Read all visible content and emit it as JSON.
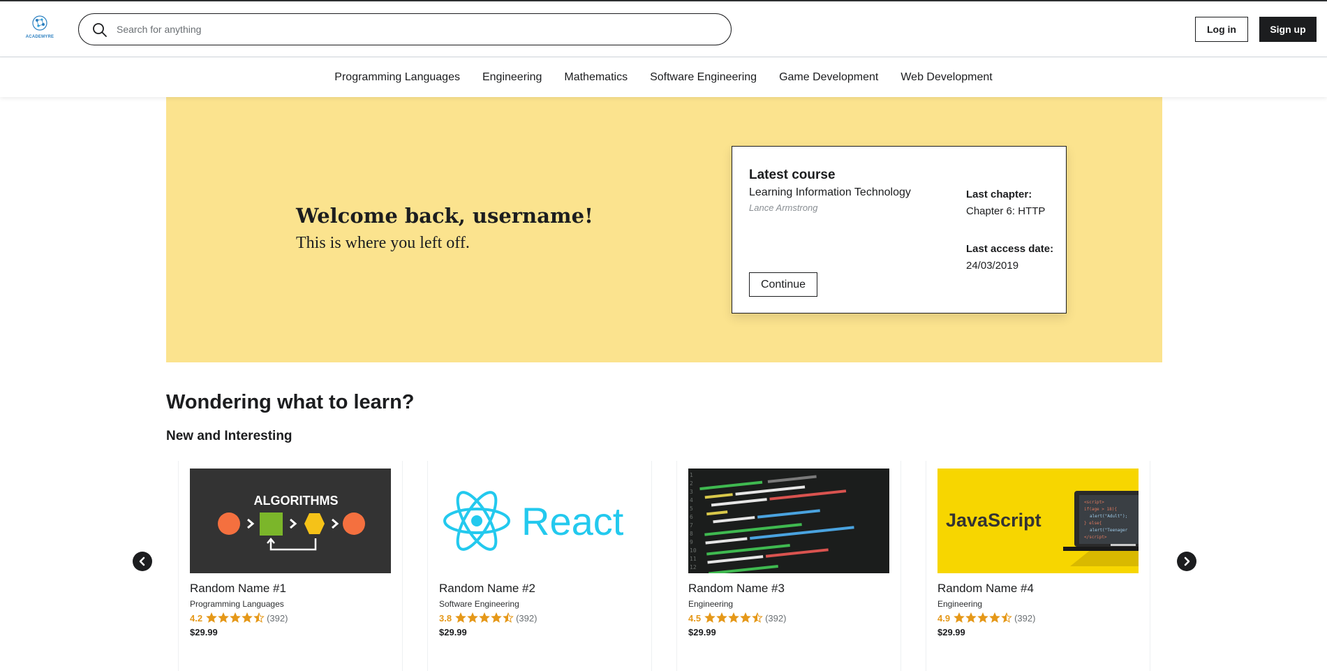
{
  "header": {
    "logo_text": "ACADEMYRE",
    "search_placeholder": "Search for anything",
    "login_label": "Log in",
    "signup_label": "Sign up"
  },
  "categories": [
    "Programming Languages",
    "Engineering",
    "Mathematics",
    "Software Engineering",
    "Game Development",
    "Web Development"
  ],
  "hero": {
    "title": "Welcome back, username!",
    "subtitle": "This is where you left off.",
    "latest_course": {
      "heading": "Latest course",
      "title": "Learning Information Technology",
      "author": "Lance Armstrong",
      "last_chapter_label": "Last chapter:",
      "last_chapter_value": "Chapter 6: HTTP",
      "last_access_label": "Last access date:",
      "last_access_value": "24/03/2019",
      "continue_label": "Continue"
    }
  },
  "section": {
    "title": "Wondering what to learn?",
    "subtitle": "New and Interesting"
  },
  "courses": [
    {
      "name": "Random Name #1",
      "category": "Programming Languages",
      "rating": "4.2",
      "stars": 4.5,
      "count": "(392)",
      "price": "$29.99",
      "image": "algorithms-thumbnail",
      "image_text": "ALGORITHMS"
    },
    {
      "name": "Random Name #2",
      "category": "Software Engineering",
      "rating": "3.8",
      "stars": 4.5,
      "count": "(392)",
      "price": "$29.99",
      "image": "react-thumbnail",
      "image_text": "React"
    },
    {
      "name": "Random Name #3",
      "category": "Engineering",
      "rating": "4.5",
      "stars": 4.5,
      "count": "(392)",
      "price": "$29.99",
      "image": "python-code-thumbnail",
      "image_text": ""
    },
    {
      "name": "Random Name #4",
      "category": "Engineering",
      "rating": "4.9",
      "stars": 4.5,
      "count": "(392)",
      "price": "$29.99",
      "image": "javascript-thumbnail",
      "image_text": "JavaScript"
    }
  ],
  "colors": {
    "hero_bg": "#fbe38e",
    "star": "#e59819",
    "dark": "#1c1d1f",
    "react_blue": "#23c9ee",
    "js_yellow": "#f7d600"
  },
  "icons": {
    "search": "search-icon",
    "carousel_prev": "chevron-left-icon",
    "carousel_next": "chevron-right-icon",
    "star": "star-icon"
  }
}
